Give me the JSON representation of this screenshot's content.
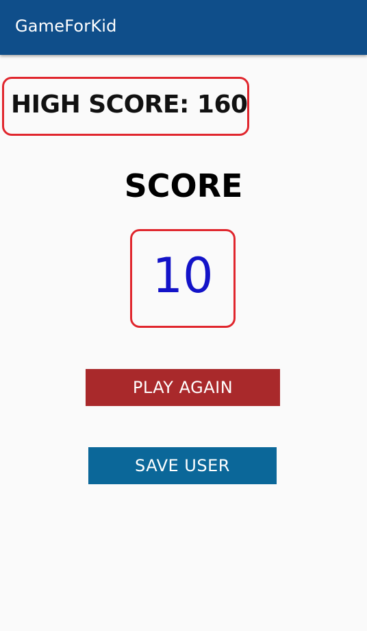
{
  "app_bar": {
    "title": "GameForKid",
    "color": "#0f4e8a"
  },
  "high_score": {
    "label": "HIGH SCORE: 160"
  },
  "score": {
    "heading": "SCORE",
    "value": "10",
    "value_color": "#1313c8"
  },
  "buttons": {
    "play_again": "PLAY AGAIN",
    "play_again_color": "#a9292b",
    "save_user": "SAVE USER",
    "save_user_color": "#0b6799"
  },
  "accent_border_color": "#e0262d"
}
